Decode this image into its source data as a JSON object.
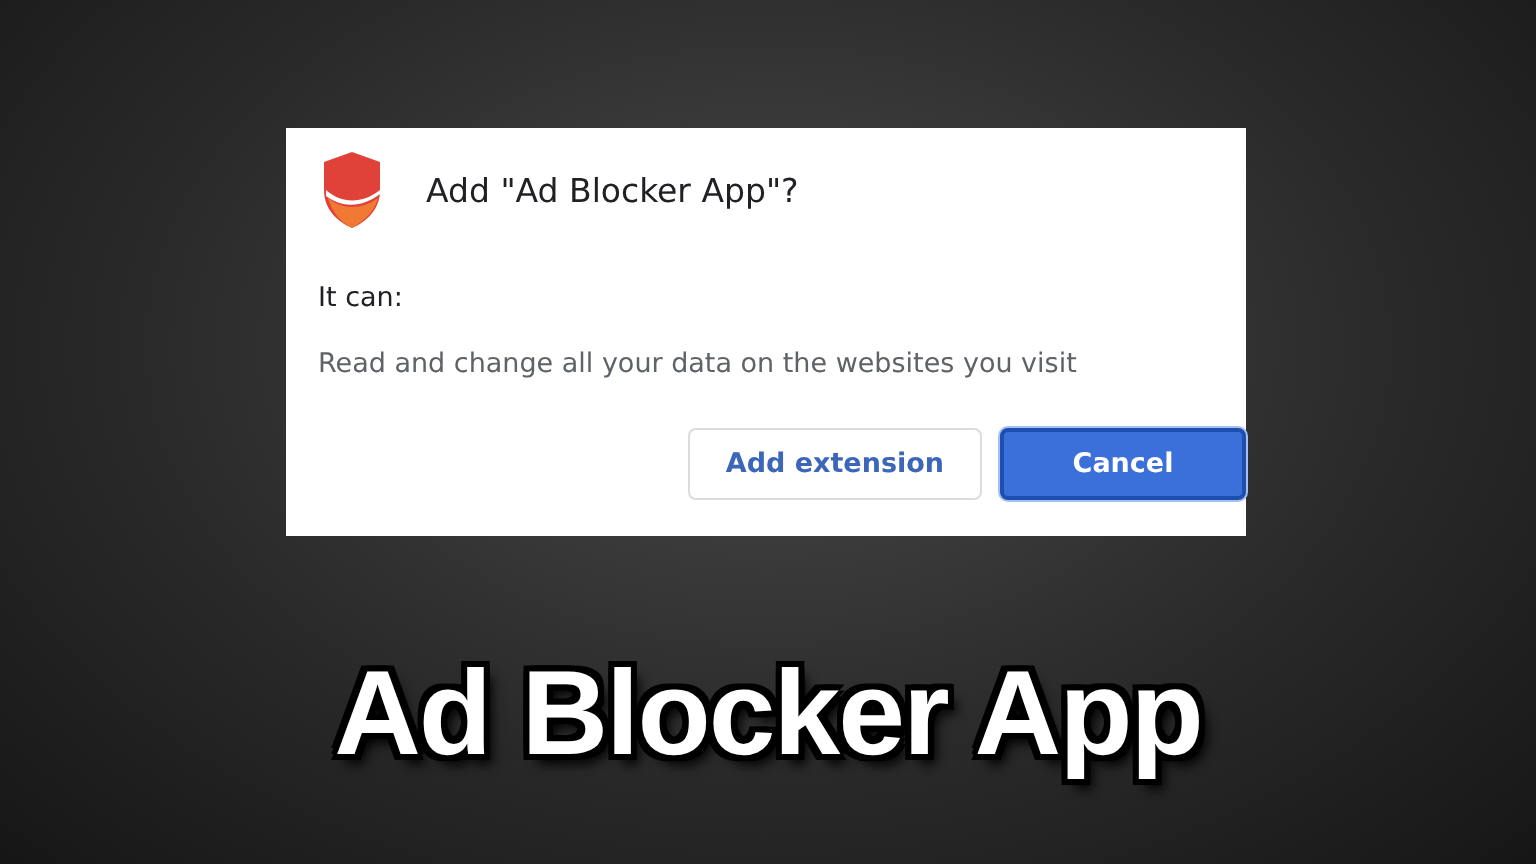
{
  "dialog": {
    "title": "Add \"Ad Blocker App\"?",
    "intro": "It can:",
    "permissions": [
      "Read and change all your data on the websites you visit"
    ],
    "buttons": [
      {
        "label": "Add extension",
        "selected": false
      },
      {
        "label": "Cancel",
        "selected": true
      }
    ]
  },
  "caption": "Ad Blocker App"
}
